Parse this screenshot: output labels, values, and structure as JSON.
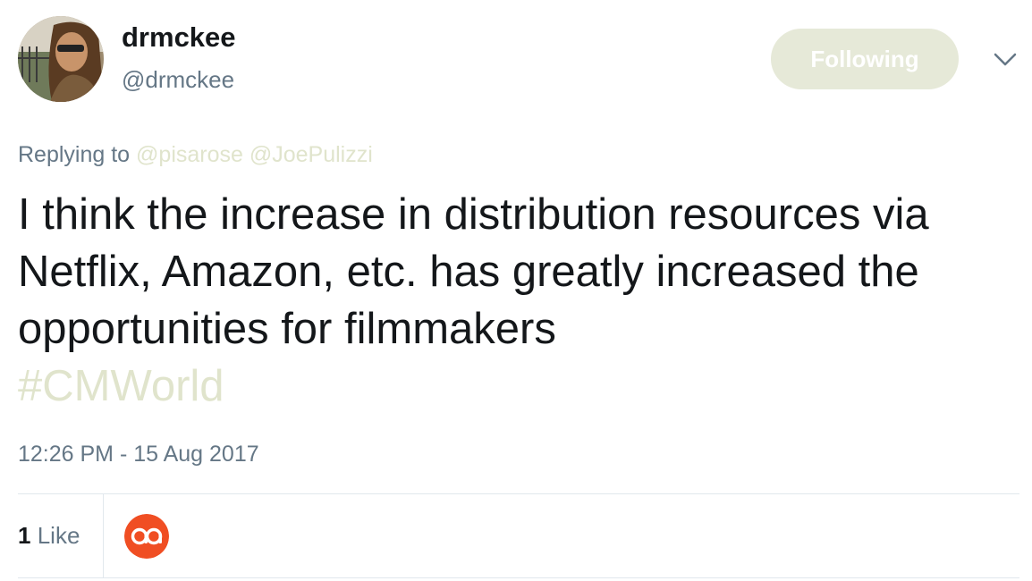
{
  "author": {
    "display_name": "drmckee",
    "screen_name": "@drmckee"
  },
  "follow_button": {
    "label": "Following"
  },
  "reply": {
    "prefix": "Replying to",
    "mentions": [
      "@pisarose",
      "@JoePulizzi"
    ]
  },
  "tweet": {
    "text": "I think the increase in distribution resources via Netflix, Amazon, etc. has greatly increased the opportunities for filmmakers",
    "hashtag": "#CMWorld",
    "timestamp": "12:26 PM - 15 Aug 2017"
  },
  "stats": {
    "like_count": "1",
    "like_label": "Like"
  },
  "icons": {
    "menu": "chevron-down-icon",
    "liker": "liker-avatar"
  },
  "colors": {
    "link": "#e0e4cc",
    "follow_button_bg": "#e6e9d8",
    "secondary_text": "#657786",
    "primary_text": "#14171a",
    "liker_avatar_bg": "#f04e23"
  }
}
